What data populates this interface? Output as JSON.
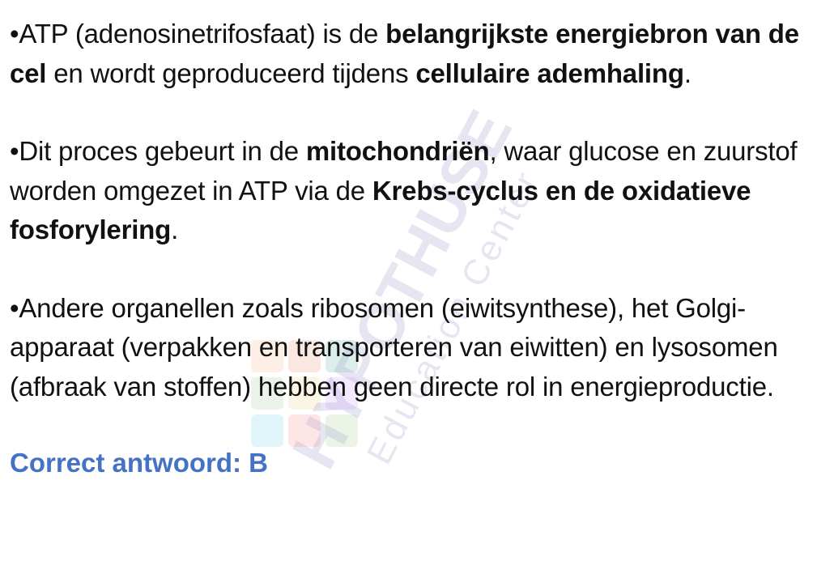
{
  "paragraphs": [
    {
      "bullet": "•",
      "segments": [
        {
          "text": "ATP (adenosinetrifosfaat) is de ",
          "bold": false
        },
        {
          "text": "belangrijkste energiebron van de cel",
          "bold": true
        },
        {
          "text": " en wordt geproduceerd tijdens ",
          "bold": false
        },
        {
          "text": "cellulaire ademhaling",
          "bold": true
        },
        {
          "text": ".",
          "bold": false
        }
      ]
    },
    {
      "bullet": "•",
      "segments": [
        {
          "text": "Dit proces gebeurt in de ",
          "bold": false
        },
        {
          "text": "mitochondriën",
          "bold": true
        },
        {
          "text": ", waar glucose en zuurstof worden omgezet in ATP via de ",
          "bold": false
        },
        {
          "text": "Krebs-cyclus en de oxidatieve fosforylering",
          "bold": true
        },
        {
          "text": ".",
          "bold": false
        }
      ]
    },
    {
      "bullet": "•",
      "segments": [
        {
          "text": "Andere organellen zoals ribosomen (eiwitsynthese), het Golgi-apparaat (verpakken en transporteren van eiwitten) en lysosomen (afbraak van stoffen) hebben geen directe rol in energieproductie.",
          "bold": false
        }
      ]
    }
  ],
  "answer": "Correct antwoord: B",
  "watermark": {
    "brand": "HYPOTHUSE",
    "tagline": "Education Center",
    "logo": "colored-puzzle-logo"
  },
  "colors": {
    "text": "#111111",
    "answer": "#4472c4",
    "watermark": "#c9cce3"
  }
}
